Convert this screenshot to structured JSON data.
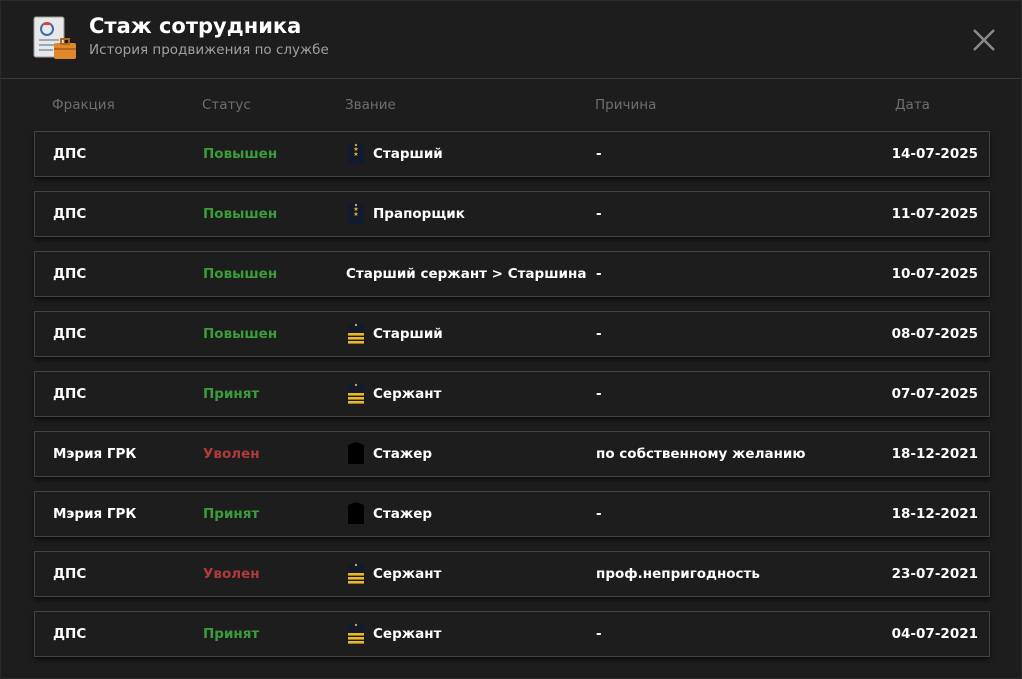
{
  "header": {
    "title": "Стаж сотрудника",
    "subtitle": "История продвижения по службе"
  },
  "columns": {
    "faction": "Фракция",
    "status": "Статус",
    "rank": "Звание",
    "reason": "Причина",
    "date": "Дата"
  },
  "colors": {
    "promoted": "#3a9d3a",
    "fired": "#b03a3a",
    "background": "#1d1d1d",
    "row_border": "#444444"
  },
  "rows": [
    {
      "faction": "ДПС",
      "status": "Повышен",
      "status_type": "promoted",
      "rank": "Старший",
      "rank_icon": "shoulder-board-star-icon",
      "reason": "-",
      "date": "14-07-2025"
    },
    {
      "faction": "ДПС",
      "status": "Повышен",
      "status_type": "promoted",
      "rank": "Прапорщик",
      "rank_icon": "shoulder-board-star-icon",
      "reason": "-",
      "date": "11-07-2025"
    },
    {
      "faction": "ДПС",
      "status": "Повышен",
      "status_type": "promoted",
      "rank": "Старший сержант > Старшина",
      "rank_icon": "",
      "reason": "-",
      "date": "10-07-2025"
    },
    {
      "faction": "ДПС",
      "status": "Повышен",
      "status_type": "promoted",
      "rank": "Старший",
      "rank_icon": "shoulder-board-stripes-icon",
      "reason": "-",
      "date": "08-07-2025"
    },
    {
      "faction": "ДПС",
      "status": "Принят",
      "status_type": "accepted",
      "rank": "Сержант",
      "rank_icon": "shoulder-board-stripes-icon",
      "reason": "-",
      "date": "07-07-2025"
    },
    {
      "faction": "Мэрия ГРК",
      "status": "Уволен",
      "status_type": "fired",
      "rank": "Стажер",
      "rank_icon": "shoulder-board-plain-icon",
      "reason": "по собственному желанию",
      "date": "18-12-2021"
    },
    {
      "faction": "Мэрия ГРК",
      "status": "Принят",
      "status_type": "accepted",
      "rank": "Стажер",
      "rank_icon": "shoulder-board-plain-icon",
      "reason": "-",
      "date": "18-12-2021"
    },
    {
      "faction": "ДПС",
      "status": "Уволен",
      "status_type": "fired",
      "rank": "Сержант",
      "rank_icon": "shoulder-board-stripes-icon",
      "reason": "проф.непригодность",
      "date": "23-07-2021"
    },
    {
      "faction": "ДПС",
      "status": "Принят",
      "status_type": "accepted",
      "rank": "Сержант",
      "rank_icon": "shoulder-board-stripes-icon",
      "reason": "-",
      "date": "04-07-2021"
    }
  ]
}
